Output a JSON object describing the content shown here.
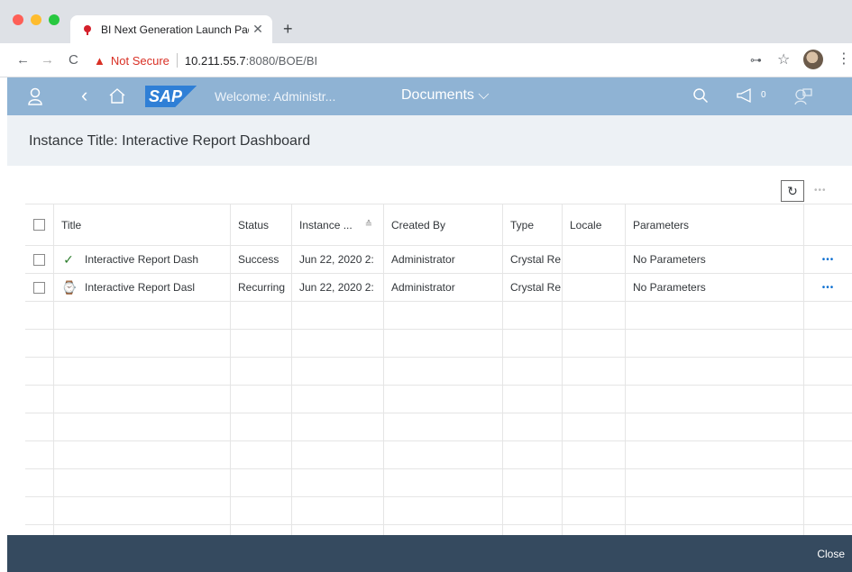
{
  "browser": {
    "tab_title": "BI Next Generation Launch Pad",
    "tab_close": "✕",
    "new_tab": "+",
    "back": "←",
    "forward": "→",
    "reload": "C",
    "security_warning": "Not Secure",
    "url_host": "10.211.55.7",
    "url_path": ":8080/BOE/BI",
    "key_icon": "⊶",
    "star_icon": "☆",
    "menu_icon": "⋮"
  },
  "shell": {
    "user_icon": "♀",
    "back_icon": "‹",
    "home_icon": "⌂",
    "logo_text": "SAP",
    "welcome": "Welcome: Administr...",
    "documents_menu": "Documents ⌵",
    "search_icon": "⚲",
    "notification_icon": "📢",
    "notification_count": "0",
    "copilot_icon": "⚇"
  },
  "page": {
    "instance_title": "Instance Title: Interactive Report Dashboard"
  },
  "toolbar": {
    "refresh_icon": "↻",
    "more_icon": "•••"
  },
  "table": {
    "columns": [
      "Title",
      "Status",
      "Instance ...",
      "Created By",
      "Type",
      "Locale",
      "Parameters"
    ],
    "sort_indicator": "≙",
    "rows": [
      {
        "status_icon": "✓",
        "title": "Interactive Report Dash",
        "status": "Success",
        "instance": "Jun 22, 2020 2:",
        "created_by": "Administrator",
        "type": "Crystal Re",
        "locale": "",
        "parameters": "No Parameters",
        "more": "•••"
      },
      {
        "status_icon": "⌚",
        "title": "Interactive Report Dasl",
        "status": "Recurring",
        "instance": "Jun 22, 2020 2:",
        "created_by": "Administrator",
        "type": "Crystal Re",
        "locale": "",
        "parameters": "No Parameters",
        "more": "•••"
      }
    ]
  },
  "footer": {
    "close_label": "Close"
  },
  "colors": {
    "shell_bar": "#8fb3d4",
    "footer": "#354a5f",
    "success": "#2b7d2b",
    "warning": "#d93025"
  }
}
